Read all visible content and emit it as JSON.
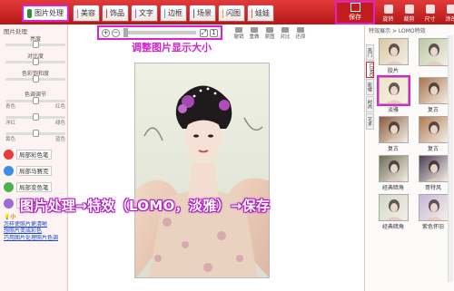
{
  "topbar": {
    "tabs": [
      {
        "label": "图片处理",
        "icon": "image-edit-icon",
        "active": true
      },
      {
        "label": "美容",
        "icon": "beauty-icon"
      },
      {
        "label": "饰品",
        "icon": "heart-icon"
      },
      {
        "label": "文字",
        "icon": "text-icon"
      },
      {
        "label": "边框",
        "icon": "frame-icon"
      },
      {
        "label": "场景",
        "icon": "scene-icon"
      },
      {
        "label": "闪图",
        "icon": "flash-icon"
      },
      {
        "label": "娃娃",
        "icon": "doll-icon"
      }
    ],
    "save_label": "保存",
    "right_buttons": [
      "旋转",
      "裁剪",
      "尺寸",
      "涂改"
    ]
  },
  "left_panel": {
    "title": "图片处理",
    "sliders": [
      {
        "label": "亮度",
        "left": "",
        "right": "",
        "value": 0.5
      },
      {
        "label": "对比度",
        "left": "",
        "right": "",
        "value": 0.5
      },
      {
        "label": "色彩饱和度",
        "left": "",
        "right": "",
        "value": 0.5
      },
      {
        "label": "色调调节",
        "left": "",
        "right": "",
        "value": 0.5
      },
      {
        "label": "",
        "left": "青色",
        "right": "红色",
        "value": 0.5
      },
      {
        "label": "",
        "left": "洋红",
        "right": "绿色",
        "value": 0.5
      },
      {
        "label": "",
        "left": "黄色",
        "right": "蓝色",
        "value": 0.5
      }
    ],
    "quick_buttons": [
      {
        "label": "局部彩色笔",
        "icon": "color-brush-icon",
        "color": "#e93b3b"
      },
      {
        "label": "局部马赛克",
        "icon": "mosaic-icon",
        "color": "#3b8de9"
      },
      {
        "label": "局部变色笔",
        "icon": "recolor-brush-icon",
        "color": "#4caf50"
      },
      {
        "label": "背景虚化",
        "icon": "blur-icon",
        "color": "#9c6bd6",
        "badge": "NEW"
      }
    ],
    "tips_title": "小",
    "tips_links": [
      "怎样使照片更清晰",
      "想照片变成彩色",
      "巧用图片处理照片色调"
    ]
  },
  "canvas": {
    "zoom_caption": "调整图片显示大小",
    "ops": [
      "撤销",
      "重做",
      "原图",
      "对比",
      "还原"
    ],
    "main_caption": "图片处理→特效（LOMO，淡雅）→保存"
  },
  "right_panel": {
    "title": "特效展示 > LOMO特效",
    "vtabs": [
      "热门",
      "LOMO",
      "影楼",
      "时尚",
      "艺术"
    ],
    "thumbs": [
      {
        "label": "胶片",
        "tint": "#d9c7a1"
      },
      {
        "label": "",
        "tint": "#b8c9a3"
      },
      {
        "label": "淡雅",
        "tint": "#efe4c4",
        "selected": true
      },
      {
        "label": "复古",
        "tint": "#a8744a"
      },
      {
        "label": "复古",
        "tint": "#8a5a3a"
      },
      {
        "label": "复古",
        "tint": "#b07a52"
      },
      {
        "label": "经典暗角",
        "tint": "#6e6e54"
      },
      {
        "label": "哥特风",
        "tint": "#4f3d55"
      },
      {
        "label": "经典暗角",
        "tint": "#d1d9c7"
      },
      {
        "label": "紫色怀旧",
        "tint": "#c7b7d8"
      }
    ]
  },
  "colors": {
    "accent": "#c21d1d",
    "highlight": "#e020d0"
  }
}
